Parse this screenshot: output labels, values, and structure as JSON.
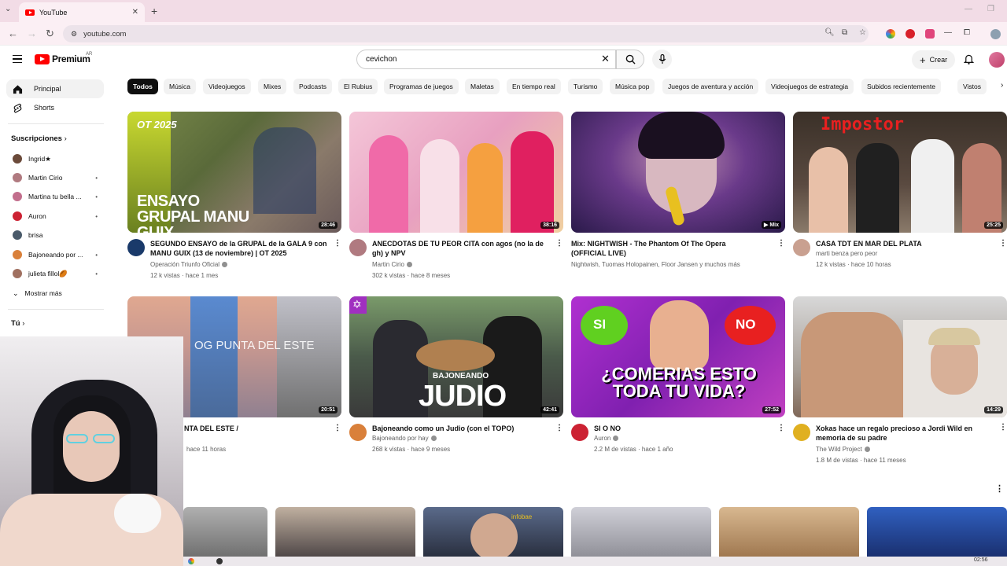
{
  "browser": {
    "tab_title": "YouTube",
    "url": "youtube.com"
  },
  "masthead": {
    "logo_text": "Premium",
    "region": "AR",
    "search_value": "cevichon",
    "create_label": "Crear"
  },
  "sidebar": {
    "main": [
      {
        "label": "Principal",
        "icon": "home-icon"
      },
      {
        "label": "Shorts",
        "icon": "shorts-icon"
      }
    ],
    "subs_header": "Suscripciones",
    "subs": [
      {
        "label": "Ingrid★",
        "color": "#6b4a3a",
        "dot": ""
      },
      {
        "label": "Martin Cirio",
        "color": "#b07a80",
        "dot": "•"
      },
      {
        "label": "Martina tu bella ...",
        "color": "#c26e8c",
        "dot": "•"
      },
      {
        "label": "Auron",
        "color": "#cc2233",
        "dot": "•"
      },
      {
        "label": "brisa",
        "color": "#4a5a6a",
        "dot": ""
      },
      {
        "label": "Bajoneando por ...",
        "color": "#d9803a",
        "dot": "•"
      },
      {
        "label": "julieta fillol🏉",
        "color": "#a07060",
        "dot": "•"
      }
    ],
    "show_more": "Mostrar más",
    "you_header": "Tú"
  },
  "chips": [
    "Todos",
    "Música",
    "Videojuegos",
    "Mixes",
    "Podcasts",
    "El Rubius",
    "Programas de juegos",
    "Maletas",
    "En tiempo real",
    "Turismo",
    "Música pop",
    "Juegos de aventura y acción",
    "Videojuegos de estrategia",
    "Subidos recientemente",
    "Vistos"
  ],
  "videos": [
    {
      "title": "SEGUNDO ENSAYO de la GRUPAL de la GALA 9 con MANU GUIX (13 de noviembre) | OT 2025",
      "channel": "Operación Triunfo Oficial",
      "stats": "12 k vistas · hace 1 mes",
      "duration": "28:46",
      "thumb_text": "ENSAYO GRUPAL MANU GUIX",
      "corner_text": "OT 2025",
      "avatar_color": "#1a3a6a"
    },
    {
      "title": "ANECDOTAS DE TU PEOR CITA con agos (no la de gh) y NPV",
      "channel": "Martin Cirio",
      "stats": "302 k vistas · hace 8 meses",
      "duration": "38:16",
      "thumb_text": "",
      "corner_text": "",
      "avatar_color": "#b07a80"
    },
    {
      "title": "Mix: NIGHTWISH - The Phantom Of The Opera (OFFICIAL LIVE)",
      "channel": "Nightwish, Tuomas Holopainen, Floor Jansen y muchos más",
      "stats": "",
      "duration": "Mix",
      "thumb_text": "",
      "corner_text": "",
      "avatar_color": ""
    },
    {
      "title": "CASA TDT EN MAR DEL PLATA",
      "channel": "marti benza pero peor",
      "stats": "12 k vistas · hace 10 horas",
      "duration": "25:25",
      "thumb_text": "Impostor",
      "corner_text": "",
      "avatar_color": "#c9a090"
    },
    {
      "title": "NTA DEL ESTE /",
      "channel": "",
      "stats": "hace 11 horas",
      "duration": "20:51",
      "thumb_text": "OG PUNTA DEL ESTE",
      "corner_text": "",
      "avatar_color": ""
    },
    {
      "title": "Bajoneando como un Judio (con el TOPO)",
      "channel": "Bajoneando por hay",
      "stats": "268 k vistas · hace 9 meses",
      "duration": "42:41",
      "thumb_text": "JUDIO",
      "corner_text": "BAJONEANDO",
      "avatar_color": "#d9803a"
    },
    {
      "title": "SI O NO",
      "channel": "Auron",
      "stats": "2.2 M de vistas · hace 1 año",
      "duration": "27:52",
      "thumb_text": "¿COMERIAS ESTO TODA TU VIDA?",
      "corner_text": "",
      "avatar_color": "#cc2233"
    },
    {
      "title": "Xokas hace un regalo precioso a Jordi Wild en memoria de su padre",
      "channel": "The Wild Project",
      "stats": "1.8 M de vistas · hace 11 meses",
      "duration": "14:29",
      "thumb_text": "",
      "corner_text": "",
      "avatar_color": "#e0b020"
    }
  ],
  "thumb_badges": {
    "si": "SI",
    "no": "NO",
    "strip_badge": "infobae"
  },
  "taskbar": {
    "time": "02:56"
  },
  "colors": {
    "brand_red": "#ff0000",
    "chip_active_bg": "#0f0f0f",
    "chip_bg": "#f2f2f2"
  }
}
